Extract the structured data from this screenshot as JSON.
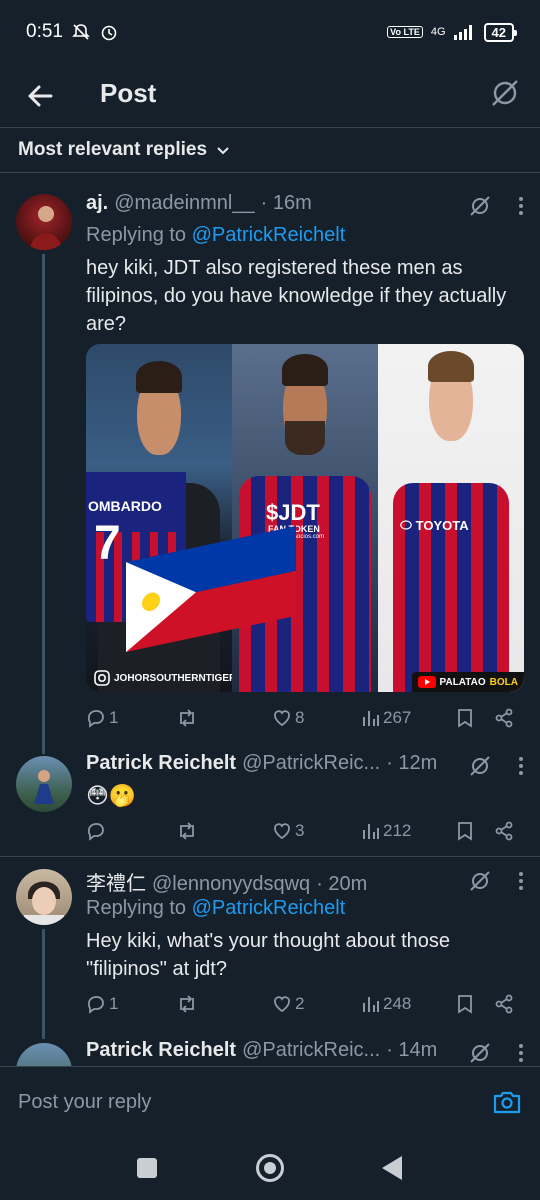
{
  "status_bar": {
    "time": "0:51",
    "network": "4G",
    "volte": "Vo LTE",
    "battery": "42"
  },
  "app_bar": {
    "title": "Post"
  },
  "filter": {
    "label": "Most relevant replies"
  },
  "replies": [
    {
      "name": "aj.",
      "handle": "@madeinmnl__",
      "time": "· 16m",
      "replying_prefix": "Replying to ",
      "replying_to": "@PatrickReichelt",
      "text": "hey kiki, JDT also registered these men as filipinos, do you have knowledge if they actually are?",
      "media": {
        "left_shirt": "OMBARDO",
        "left_number": "7",
        "left_caption": "JOHORSOUTHERNTIGERS",
        "mid_logo": "$JDT",
        "mid_sub": "FAN TOKEN",
        "mid_sub2": "by socios.com",
        "right_sponsor": "TOYOTA",
        "right_caption_a": "PALATAO",
        "right_caption_b": "BOLA"
      },
      "replies": "1",
      "reposts": "",
      "likes": "8",
      "views": "267"
    },
    {
      "name": "Patrick Reichelt",
      "handle": "@PatrickReic...",
      "time": "· 12m",
      "text": "😳🫢",
      "replies": "",
      "reposts": "",
      "likes": "3",
      "views": "212"
    },
    {
      "name": "李禮仁",
      "handle": "@lennonyydsqwq",
      "time": "· 20m",
      "replying_prefix": "Replying to ",
      "replying_to": "@PatrickReichelt",
      "text": "Hey kiki, what's your thought about those \"filipinos\" at jdt?",
      "replies": "1",
      "reposts": "",
      "likes": "2",
      "views": "248"
    },
    {
      "name": "Patrick Reichelt",
      "handle": "@PatrickReic...",
      "time": "· 14m"
    }
  ],
  "composer": {
    "placeholder": "Post your reply"
  },
  "colors": {
    "background": "#15202b",
    "link": "#1d9bf0",
    "muted": "#8b98a5",
    "text": "#e7e9ea"
  }
}
